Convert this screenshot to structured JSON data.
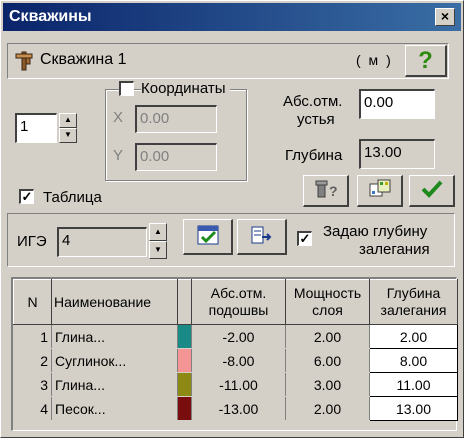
{
  "window": {
    "title": "Скважины",
    "close_glyph": "×"
  },
  "well": {
    "name": "Скважина 1",
    "unit_badge": "( м )",
    "help_glyph": "?"
  },
  "counter": {
    "value": "1"
  },
  "coords": {
    "label": "Координаты",
    "checked": false,
    "x_label": "X",
    "x_value": "0.00",
    "y_label": "Y",
    "y_value": "0.00"
  },
  "mouth": {
    "label_line1": "Абс.отм.",
    "label_line2": "устья",
    "value": "0.00"
  },
  "depth": {
    "label": "Глубина",
    "value": "13.00"
  },
  "table_toggle": {
    "label": "Таблица",
    "checked": true,
    "check_glyph": "✓"
  },
  "ige": {
    "label": "ИГЭ",
    "value": "4"
  },
  "set_depth": {
    "label_line1": "Задаю глубину",
    "label_line2": "залегания",
    "checked": true,
    "check_glyph": "✓"
  },
  "grid": {
    "headers": {
      "n": "N",
      "name": "Наименование",
      "abs_line1": "Абс.отм.",
      "abs_line2": "подошвы",
      "thick_line1": "Мощность",
      "thick_line2": "слоя",
      "depth_line1": "Глубина",
      "depth_line2": "залегания"
    },
    "rows": [
      {
        "n": "1",
        "name": "Глина...",
        "color": "#1a8a87",
        "abs": "-2.00",
        "thick": "2.00",
        "depth": "2.00"
      },
      {
        "n": "2",
        "name": "Суглинок...",
        "color": "#f49494",
        "abs": "-8.00",
        "thick": "6.00",
        "depth": "8.00"
      },
      {
        "n": "3",
        "name": "Глина...",
        "color": "#8c8a14",
        "abs": "-11.00",
        "thick": "3.00",
        "depth": "11.00"
      },
      {
        "n": "4",
        "name": "Песок...",
        "color": "#7a0e0e",
        "abs": "-13.00",
        "thick": "2.00",
        "depth": "13.00"
      }
    ]
  },
  "icons": {
    "well_icon": "well-rig-icon",
    "help_icon": "question-icon",
    "probe_icon": "probe-help-icon",
    "table_icon": "grid-table-icon",
    "ok_icon": "checkmark-icon",
    "ige_table_icon": "table-check-icon",
    "ige_export_icon": "export-arrow-icon"
  }
}
